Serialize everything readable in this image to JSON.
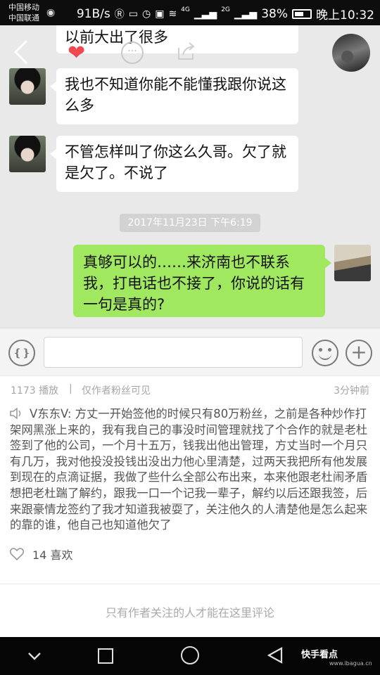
{
  "status_bar": {
    "carrier_1": "中国移动",
    "carrier_2": "中国联通",
    "speed": "91B/s",
    "signal_a": "4G",
    "signal_b": "2G",
    "battery": "38%",
    "time": "晚上10:32"
  },
  "chat": {
    "top_partial_message": "以前大出了很多",
    "messages": [
      {
        "side": "left",
        "text": "我也不知道你能不能懂我跟你说这么多"
      },
      {
        "side": "left",
        "text": "不管怎样叫了你这么久哥。欠了就是欠了。不说了"
      }
    ],
    "timestamp": "2017年11月23日 下午6:19",
    "sent_message": "真够可以的……来济南也不联系我，打电话也不接了，你说的话有一句是真的?",
    "more_glyph": "···"
  },
  "post": {
    "plays": "1173 播放",
    "separator": "|",
    "visibility": "仅作者粉丝可见",
    "posted": "3分钟前",
    "caption": "V东东V: 方丈一开始签他的时候只有80万粉丝，之前是各种炒作打架网黑涨上来的，我有我自己的事没时间管理就找了个合作的就是老杜签到了他的公司，一个月十五万，钱我出他出管理，方丈当时一个月只有几万，我对他投没投钱出没出力他心里清楚，过两天我把所有他发展到现在的点滴证据，我做了些什么全部公布出来，本来他跟老杜闹矛盾想把老杜踹了解约，跟我一口一个记我一辈子，解约以后还跟我签，后来跟豪情龙签约了我才知道我被耍了，关注他久的人清楚他是怎么起来的靠的谁，他自己也知道他欠了",
    "likes": "14 喜欢",
    "comment_note": "只有作者关注的人才能在这里评论"
  },
  "watermark": {
    "main": "快手看点",
    "sub": "www.ibagua.cn"
  }
}
